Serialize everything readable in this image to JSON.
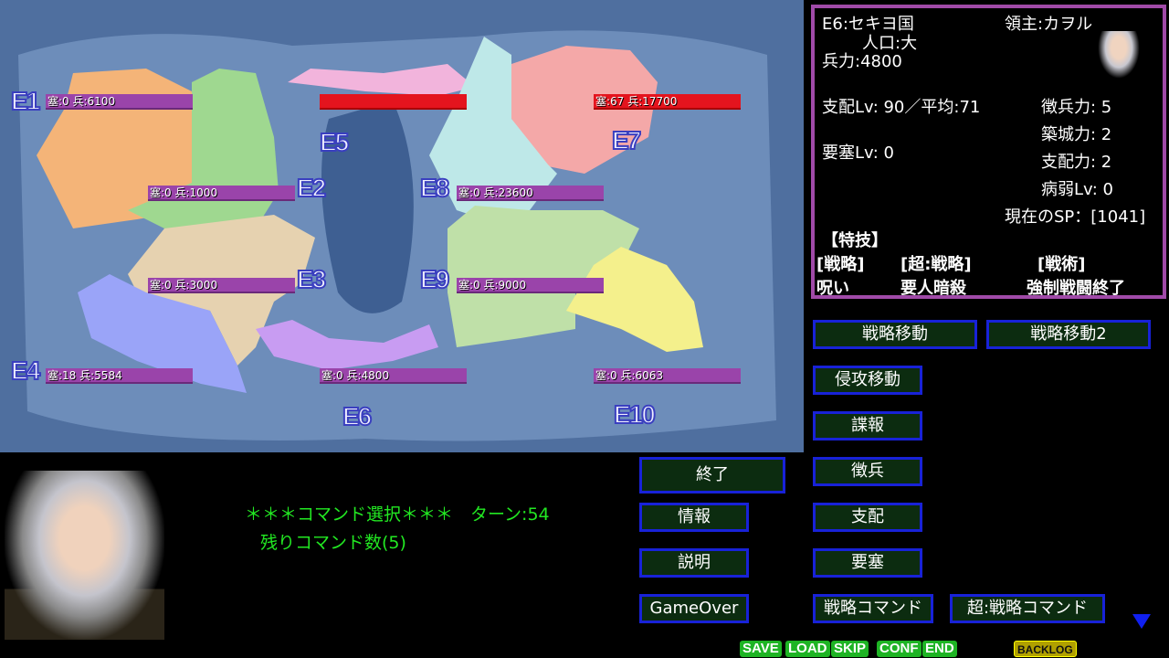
{
  "map": {
    "regions": [
      {
        "id": "E1",
        "label": "E1",
        "status": "塞:0 兵:6100",
        "color": "#f4b478",
        "bar": "purple"
      },
      {
        "id": "E2",
        "label": "E2",
        "status": "塞:0 兵:1000",
        "color": "#9fd890",
        "bar": "purple"
      },
      {
        "id": "E3",
        "label": "E3",
        "status": "塞:0 兵:3000",
        "color": "#e6d2b0",
        "bar": "purple"
      },
      {
        "id": "E4",
        "label": "E4",
        "status": "塞:18 兵:5584",
        "color": "#9aa4f8",
        "bar": "purple"
      },
      {
        "id": "E5",
        "label": "E5",
        "status": "",
        "color": "#f2b4dc",
        "bar": "red"
      },
      {
        "id": "E6",
        "label": "E6",
        "status": "塞:0 兵:4800",
        "color": "#c89cf2",
        "bar": "purple"
      },
      {
        "id": "E7",
        "label": "E7",
        "status": "塞:67 兵:17700",
        "color": "#f4a8a8",
        "bar": "red"
      },
      {
        "id": "E8",
        "label": "E8",
        "status": "塞:0 兵:23600",
        "color": "#bee8e8",
        "bar": "purple"
      },
      {
        "id": "E9",
        "label": "E9",
        "status": "塞:0 兵:9000",
        "color": "#bfe0a8",
        "bar": "purple"
      },
      {
        "id": "E10",
        "label": "E10",
        "status": "塞:0 兵:6063",
        "color": "#f4f08c",
        "bar": "purple"
      }
    ]
  },
  "info": {
    "province": "E6:セキヨ国",
    "lord": "領主:カヲル",
    "population": "人口:大",
    "troops": "兵力:4800",
    "control": "支配Lv: 90／平均:71",
    "fort": "要塞Lv: 0",
    "recruit": "徴兵力: 5",
    "build": "築城力: 2",
    "rule": "支配力: 2",
    "sick": "病弱Lv: 0",
    "sp": "現在のSP：[1041]",
    "skills_title": "【特技】",
    "skill_headers": [
      "[戦略]",
      "[超:戦略]",
      "[戦術]"
    ],
    "skills": [
      "呪い",
      "要人暗殺",
      "強制戦闘終了"
    ]
  },
  "message": {
    "line1": "＊＊＊コマンド選択＊＊＊　ターン:54",
    "line2": "残りコマンド数(5)"
  },
  "commands": {
    "move": "戦略移動",
    "move2": "戦略移動2",
    "invade": "侵攻移動",
    "spy": "諜報",
    "recruit": "徴兵",
    "rule": "支配",
    "fort": "要塞",
    "strategy": "戦略コマンド",
    "super": "超:戦略コマンド",
    "end": "終了",
    "info": "情報",
    "help": "説明",
    "gameover": "GameOver"
  },
  "system": {
    "save": "SAVE",
    "load": "LOAD",
    "skip": "SKIP",
    "conf": "CONF",
    "end": "END",
    "backlog": "BACKLOG"
  },
  "colors": {
    "button_border": "#1822d8",
    "button_bg": "#0c2c10",
    "panel_border": "#a04aa8",
    "message": "#22e822"
  }
}
